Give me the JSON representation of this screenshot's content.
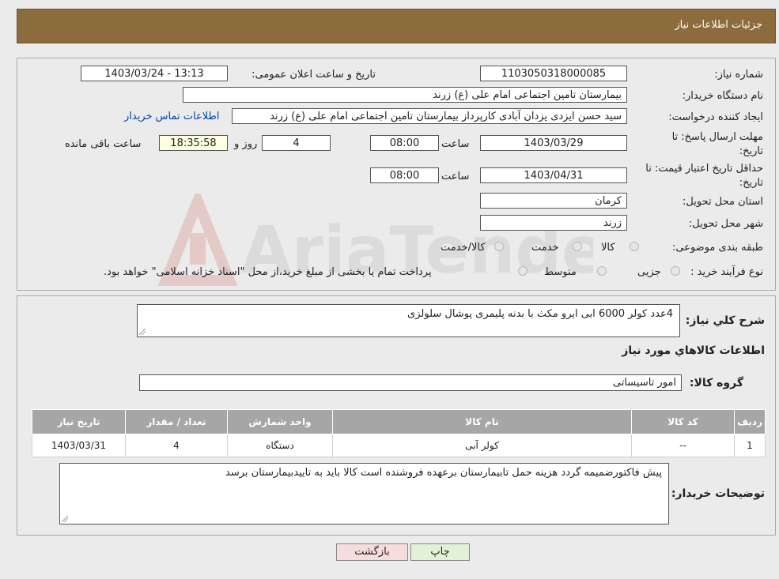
{
  "header": {
    "title": "جزئیات اطلاعات نیاز"
  },
  "details": {
    "need_number_label": "شماره نیاز:",
    "need_number": "1103050318000085",
    "announce_label": "تاریخ و ساعت اعلان عمومی:",
    "announce_value": "1403/03/24 - 13:13",
    "buyer_label": "نام دستگاه خریدار:",
    "buyer_value": "بیمارستان تامین اجتماعی امام علی (ع) زرند",
    "creator_label": "ایجاد کننده درخواست:",
    "creator_value": "سید حسن ایزدی یزدان آبادی کارپرداز بیمارستان تامین اجتماعی امام علی (ع) زرند",
    "contact_link": "اطلاعات تماس خریدار",
    "deadline_label_1": "مهلت ارسال پاسخ: تا",
    "deadline_label_2": "تاریخ:",
    "deadline_date": "1403/03/29",
    "time_label": "ساعت",
    "deadline_time": "08:00",
    "days_value": "4",
    "days_label": "روز و",
    "remaining_time": "18:35:58",
    "remaining_label": "ساعت باقی مانده",
    "validity_label_1": "حداقل تاریخ اعتبار قیمت: تا",
    "validity_label_2": "تاریخ:",
    "validity_date": "1403/04/31",
    "validity_time": "08:00",
    "province_label": "استان محل تحویل:",
    "province_value": "کرمان",
    "city_label": "شهر محل تحویل:",
    "city_value": "زرند",
    "category_label": "طبقه بندی موضوعی:",
    "category_options": [
      "کالا",
      "خدمت",
      "کالا/خدمت"
    ],
    "process_label": "نوع فرآیند خرید :",
    "process_options": [
      "جزیی",
      "متوسط"
    ],
    "process_note": "پرداخت تمام یا بخشی از مبلغ خرید،از محل \"اسناد خزانه اسلامی\" خواهد بود."
  },
  "description": {
    "label": "شرح کلي نياز:",
    "value": "4عدد کولر 6000 ابی  ایرو مکث با بدنه پلیمری پوشال سلولزی"
  },
  "goods": {
    "section_title": "اطلاعات کالاهاي مورد نياز",
    "group_label": "گروه کالا:",
    "group_value": "امور تاسیساتی",
    "headers": [
      "رديف",
      "کد کالا",
      "نام کالا",
      "واحد شمارش",
      "تعداد / مقدار",
      "تاريخ نياز"
    ],
    "rows": [
      [
        "1",
        "--",
        "کولر آبی",
        "دستگاه",
        "4",
        "1403/03/31"
      ]
    ]
  },
  "buyer_notes": {
    "label": "توضيحات خريدار:",
    "value": "پیش فاکتورضمیمه گردد هزینه حمل تابیمارستان برعهده فروشنده است کالا باید به تاییدبیمارستان برسد"
  },
  "buttons": {
    "print": "چاپ",
    "back": "بازگشت"
  },
  "watermark": {
    "text": "AriaTender.neT"
  },
  "colors": {
    "header": "#8c6b3d",
    "back_button": "#f7dcdc",
    "print_button": "#e3f2d7"
  }
}
